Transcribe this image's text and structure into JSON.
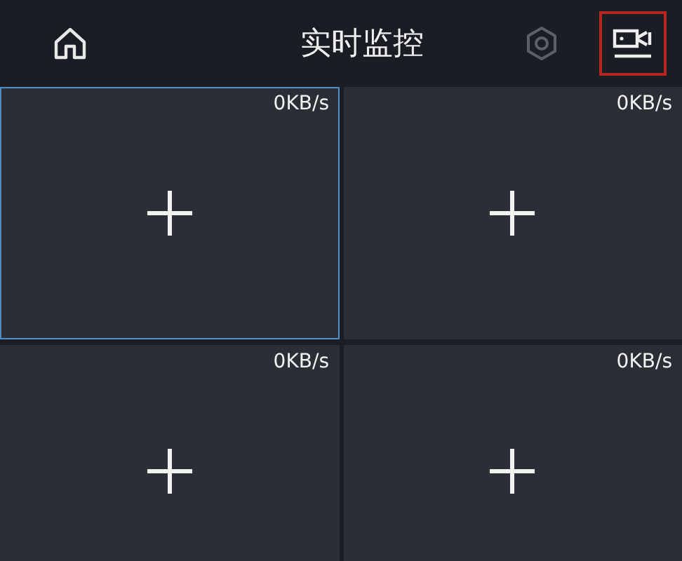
{
  "header": {
    "title": "实时监控",
    "settings": {
      "disabled": true
    },
    "record": {
      "highlighted": true
    }
  },
  "tiles": [
    {
      "rate": "0KB/s",
      "selected": true
    },
    {
      "rate": "0KB/s",
      "selected": false
    },
    {
      "rate": "0KB/s",
      "selected": false
    },
    {
      "rate": "0KB/s",
      "selected": false
    }
  ]
}
